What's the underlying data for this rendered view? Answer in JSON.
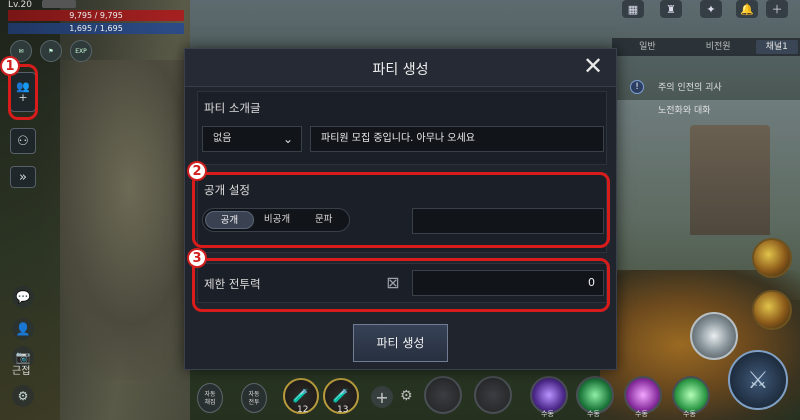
{
  "hud": {
    "level": "Lv.20",
    "hp": "9,795 / 9,795",
    "mp": "1,695 / 1,695",
    "exp_label": "EXP",
    "side_label": "근접"
  },
  "right_hud": {
    "tabs": [
      "일반",
      "비전원",
      "채널1"
    ],
    "quest_title": "주의 인전의 괴사",
    "quest_sub": "노전화와 대화"
  },
  "bottom_bar": {
    "auto1": "자동\n채집",
    "auto2": "자동\n전투",
    "potion1_count": "12",
    "potion2_count": "13",
    "skill_label": "수동"
  },
  "callouts": [
    "1",
    "2",
    "3"
  ],
  "modal": {
    "title": "파티 생성",
    "intro_section_title": "파티 소개글",
    "intro_select_value": "없음",
    "intro_text_value": "파티원 모집 중입니다. 아무나 오세요",
    "visibility_title": "공개 설정",
    "visibility_options": [
      "공개",
      "비공개",
      "문파"
    ],
    "visibility_selected": "공개",
    "power_title": "제한 전투력",
    "power_value": "0",
    "create_button": "파티 생성"
  }
}
